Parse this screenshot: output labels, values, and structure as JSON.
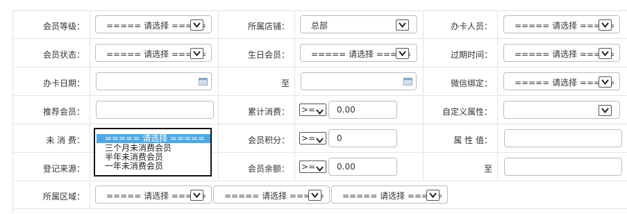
{
  "labels": {
    "member_level": "会员等级：",
    "store": "所属店铺：",
    "card_staff": "办卡人员：",
    "member_status": "会员状态：",
    "birthday_member": "生日会员：",
    "expire_time": "过期时间：",
    "card_date": "办卡日期：",
    "to1": "至",
    "wechat_bind": "微信绑定：",
    "referrer": "推荐会员：",
    "total_spend": "累计消费：",
    "custom_attr": "自定义属性：",
    "no_spend": "未 消 费：",
    "points": "会员积分：",
    "attr_value": "属 性 值：",
    "reg_source": "登记来源：",
    "balance": "会员余额：",
    "to2": "至",
    "region": "所属区域："
  },
  "selects": {
    "placeholder": "===== 请选择 =====",
    "store_value": "总部"
  },
  "operators": {
    "total_spend": ">=",
    "points": ">=",
    "balance": ">="
  },
  "inputs": {
    "total_spend": "0.00",
    "points": "0",
    "balance": "0.00"
  },
  "dropdown": {
    "options": [
      "===== 请选择 =====",
      "三个月未消费会员",
      "半年未消费会员",
      "一年未消费会员"
    ],
    "selected_index": 0
  }
}
